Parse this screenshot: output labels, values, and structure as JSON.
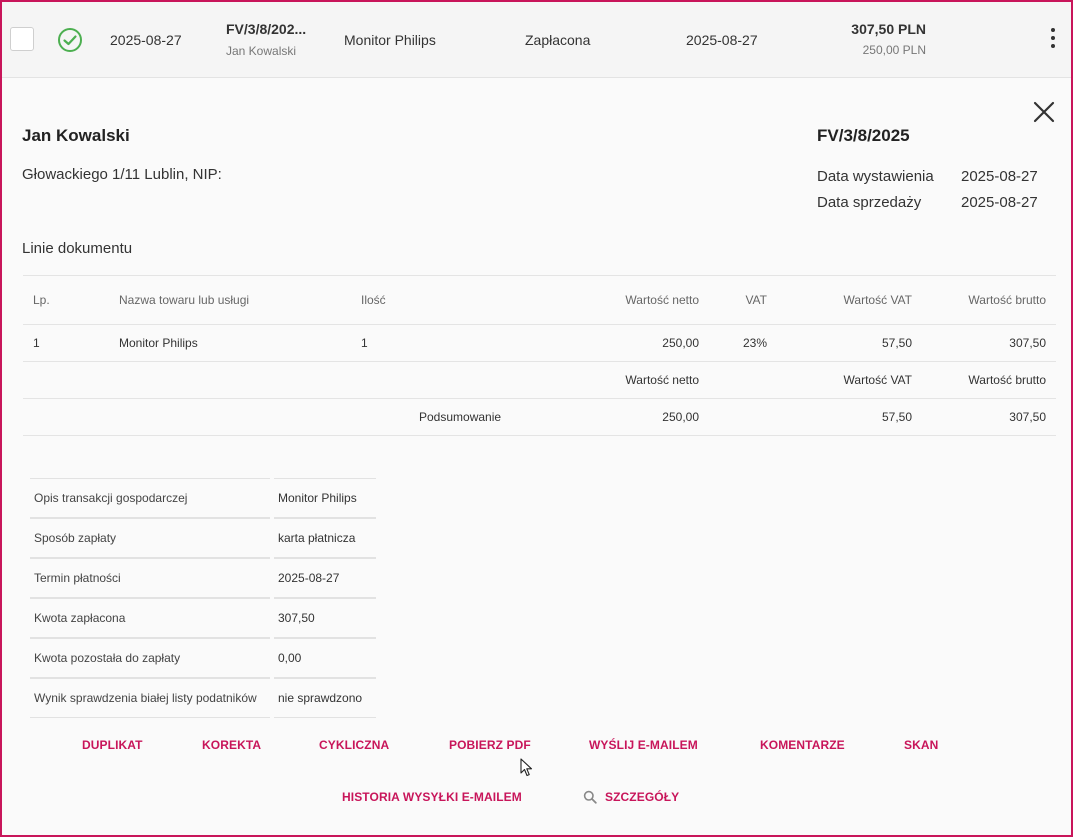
{
  "row": {
    "date": "2025-08-27",
    "number": "FV/3/8/202...",
    "client": "Jan Kowalski",
    "product": "Monitor Philips",
    "status": "Zapłacona",
    "date2": "2025-08-27",
    "gross": "307,50 PLN",
    "net": "250,00 PLN"
  },
  "header": {
    "name": "Jan Kowalski",
    "address": "Głowackiego 1/11 Lublin, NIP:",
    "doc_number": "FV/3/8/2025",
    "issue_label": "Data wystawienia",
    "issue_date": "2025-08-27",
    "sale_label": "Data sprzedaży",
    "sale_date": "2025-08-27"
  },
  "lines_title": "Linie dokumentu",
  "lines_table": {
    "headers": [
      "Lp.",
      "Nazwa towaru lub usługi",
      "Ilość",
      "Wartość netto",
      "VAT",
      "Wartość VAT",
      "Wartość brutto"
    ],
    "rows": [
      [
        "1",
        "Monitor Philips",
        "1",
        "250,00",
        "23%",
        "57,50",
        "307,50"
      ]
    ],
    "summary_headers": [
      "Wartość netto",
      "Wartość VAT",
      "Wartość brutto"
    ],
    "summary_label": "Podsumowanie",
    "summary_values": [
      "250,00",
      "57,50",
      "307,50"
    ]
  },
  "info": [
    {
      "key": "Opis transakcji gospodarczej",
      "value": "Monitor Philips"
    },
    {
      "key": "Sposób zapłaty",
      "value": "karta płatnicza"
    },
    {
      "key": "Termin płatności",
      "value": "2025-08-27"
    },
    {
      "key": "Kwota zapłacona",
      "value": "307,50"
    },
    {
      "key": "Kwota pozostała do zapłaty",
      "value": "0,00"
    },
    {
      "key": "Wynik sprawdzenia białej listy podatników",
      "value": "nie sprawdzono"
    }
  ],
  "actions": {
    "duplikat": "DUPLIKAT",
    "korekta": "KOREKTA",
    "cykliczna": "CYKLICZNA",
    "pdf": "POBIERZ PDF",
    "email": "WYŚLIJ E-MAILEM",
    "komentarze": "KOMENTARZE",
    "skan": "SKAN",
    "historia": "HISTORIA WYSYŁKI E-MAILEM",
    "szczegoly": "SZCZEGÓŁY"
  },
  "colors": {
    "accent": "#c8155a",
    "paid_green": "#4caf50"
  }
}
